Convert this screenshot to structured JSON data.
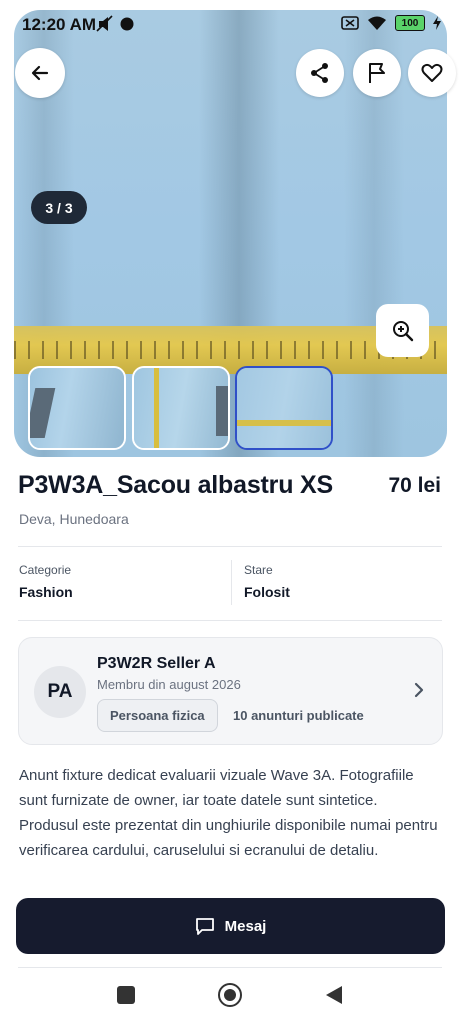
{
  "status_bar": {
    "time": "12:20 AM",
    "battery": "100"
  },
  "gallery": {
    "counter": "3 / 3",
    "thumbnails": [
      "thumb-1",
      "thumb-2",
      "thumb-3"
    ],
    "active_index": 3
  },
  "listing": {
    "title": "P3W3A_Sacou albastru XS",
    "price": "70 lei",
    "location": "Deva, Hunedoara",
    "category_label": "Categorie",
    "category_value": "Fashion",
    "condition_label": "Stare",
    "condition_value": "Folosit",
    "description": "Anunt fixture dedicat evaluarii vizuale Wave 3A. Fotografiile sunt furnizate de owner, iar toate datele sunt sintetice. Produsul este prezentat din unghiurile disponibile numai pentru verificarea cardului, caruselului si ecranului de detaliu."
  },
  "seller": {
    "initials": "PA",
    "name": "P3W2R Seller A",
    "member_since": "Membru din august 2026",
    "type": "Persoana fizica",
    "ads_count": "10 anunturi publicate"
  },
  "actions": {
    "message_label": "Mesaj"
  },
  "colors": {
    "primary_dark": "#161b2e",
    "active_thumb_border": "#3050c8"
  }
}
